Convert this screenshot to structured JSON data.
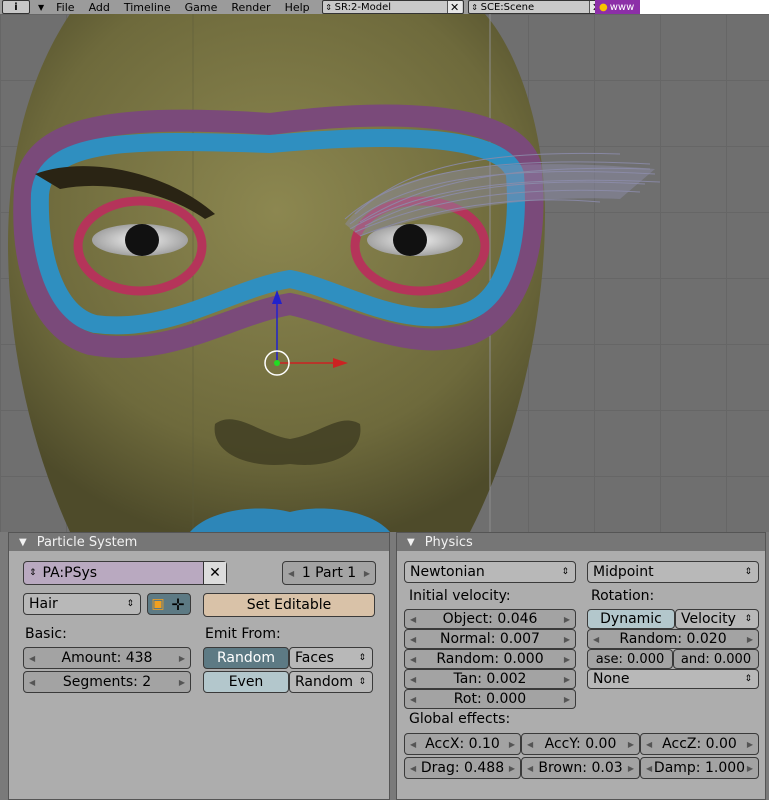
{
  "menubar": {
    "info_icon": "i",
    "items": [
      "File",
      "Add",
      "Timeline",
      "Game",
      "Render",
      "Help"
    ],
    "screen_field": "SR:2-Model",
    "scene_field": "SCE:Scene",
    "www_label": "www"
  },
  "particle_system": {
    "header": "Particle System",
    "psys_name": "PA:PSys",
    "part_label": "1 Part 1",
    "type_menu": "Hair",
    "set_editable": "Set Editable",
    "basic_label": "Basic:",
    "amount": "Amount: 438",
    "segments": "Segments: 2",
    "emit_from_label": "Emit From:",
    "emit_random": "Random",
    "emit_faces": "Faces",
    "emit_even": "Even",
    "emit_dist": "Random"
  },
  "physics": {
    "header": "Physics",
    "physics_type": "Newtonian",
    "integrator": "Midpoint",
    "initial_velocity_label": "Initial velocity:",
    "object": "Object: 0.046",
    "normal": "Normal: 0.007",
    "random": "Random: 0.000",
    "tan": "Tan: 0.002",
    "rot": "Rot: 0.000",
    "rotation_label": "Rotation:",
    "dynamic": "Dynamic",
    "velocity": "Velocity",
    "rot_random": "Random: 0.020",
    "phase": "ase: 0.000",
    "phase_rand": "and: 0.000",
    "rot_none": "None",
    "global_effects_label": "Global effects:",
    "accx": "AccX: 0.10",
    "accy": "AccY: 0.00",
    "accz": "AccZ: 0.00",
    "drag": "Drag: 0.488",
    "brown": "Brown: 0.03",
    "damp": "Damp: 1.000"
  }
}
